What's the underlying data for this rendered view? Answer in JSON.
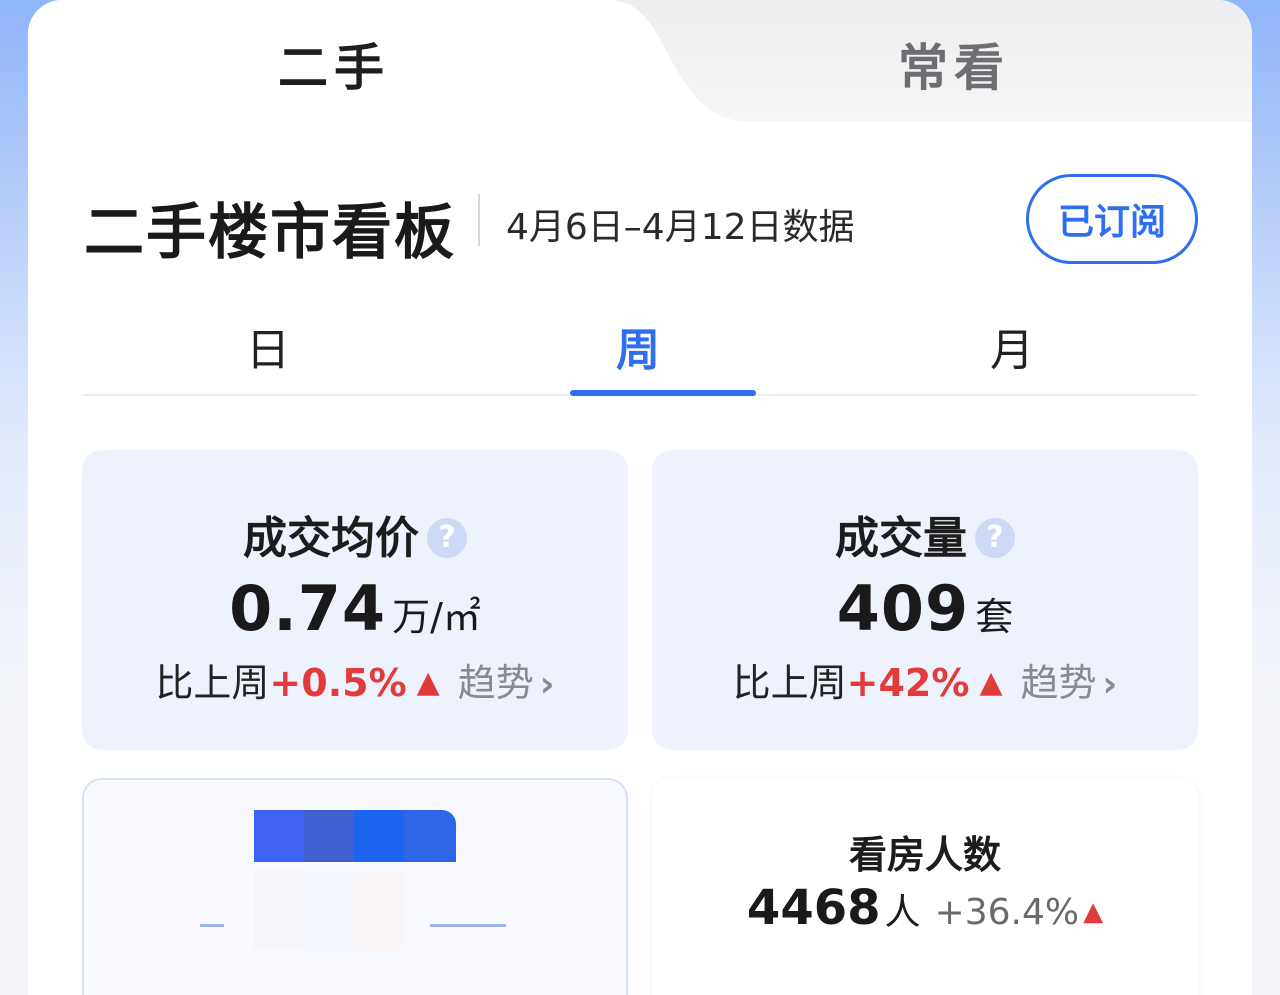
{
  "top_tabs": [
    {
      "label": "二手",
      "active": true
    },
    {
      "label": "常看",
      "active": false
    }
  ],
  "header": {
    "title": "二手楼市看板",
    "date_range": "4月6日–4月12日数据",
    "subscribe_label": "已订阅"
  },
  "period_tabs": [
    {
      "label": "日",
      "active": false
    },
    {
      "label": "周",
      "active": true
    },
    {
      "label": "月",
      "active": false
    }
  ],
  "stats": [
    {
      "label": "成交均价",
      "value": "0.74",
      "unit": "万/㎡",
      "compare_label": "比上周",
      "change": "+0.5%",
      "trend_label": "趋势"
    },
    {
      "label": "成交量",
      "value": "409",
      "unit": "套",
      "compare_label": "比上周",
      "change": "+42%",
      "trend_label": "趋势"
    }
  ],
  "viewers": {
    "label": "看房人数",
    "value": "4468",
    "unit": "人",
    "change": "+36.4%"
  },
  "icons": {
    "help": "question-mark-icon",
    "up": "triangle-up-icon",
    "chevron": "chevron-right-icon"
  },
  "colors": {
    "accent": "#2e6ff0",
    "increase": "#e23b3b",
    "card_bg": "#eef2fc"
  }
}
